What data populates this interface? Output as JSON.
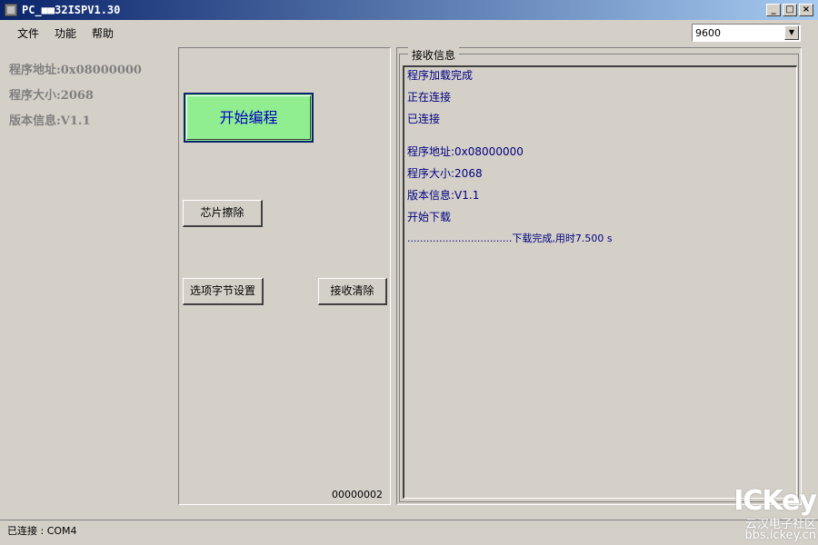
{
  "window": {
    "title": "PC_■■32ISPV1.30",
    "min": "_",
    "max": "□",
    "close": "×"
  },
  "menu": [
    "文件",
    "功能",
    "帮助"
  ],
  "baud": {
    "value": "9600",
    "arrow": "▼"
  },
  "left_info": [
    "程序地址:0x08000000",
    "程序大小:2068",
    "版本信息:V1.1"
  ],
  "buttons": {
    "start": "开始编程",
    "erase": "芯片擦除",
    "option_bytes": "选项字节设置",
    "clear_recv": "接收清除"
  },
  "counter": "00000002",
  "recv": {
    "legend": "接收信息",
    "lines": [
      "程序加载完成",
      "正在连接",
      "已连接",
      "程序地址:0x08000000",
      "程序大小:2068",
      "版本信息:V1.1",
      "开始下载",
      ".................................下载完成,用时7.500 s"
    ]
  },
  "status": "已连接 : COM4",
  "watermark": {
    "brand": "ICKey",
    "cn": "云汉电子社区",
    "url": "bbs.ickey.cn"
  },
  "colors": {
    "titlebar": "#0a246a",
    "start_button": "#90ee90",
    "recv_text": "#000080"
  }
}
